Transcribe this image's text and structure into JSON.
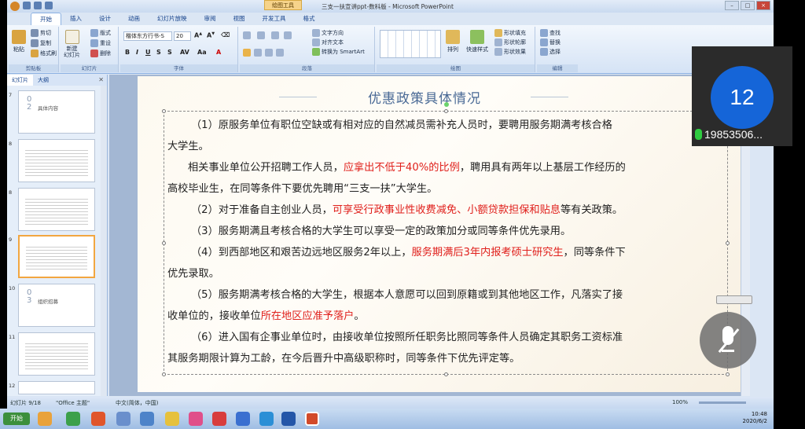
{
  "window": {
    "title": "三支一扶宣讲ppt-数科版 - Microsoft PowerPoint",
    "context_tab": "绘图工具"
  },
  "tabs": [
    "开始",
    "插入",
    "设计",
    "动画",
    "幻灯片放映",
    "审阅",
    "视图",
    "开发工具",
    "格式"
  ],
  "ribbon": {
    "clipboard": {
      "paste": "粘贴",
      "cut": "剪切",
      "copy": "复制",
      "format_painter": "格式刷",
      "label": "剪贴板"
    },
    "slides": {
      "new_slide": "新建\n幻灯片",
      "layout": "版式",
      "reset": "重设",
      "delete": "删除",
      "label": "幻灯片"
    },
    "font": {
      "family": "楷体东方行书-S",
      "size": "20",
      "label": "字体"
    },
    "paragraph": {
      "text_direction": "文字方向",
      "align_text": "对齐文本",
      "smartart": "转换为 SmartArt",
      "label": "段落"
    },
    "drawing": {
      "arrange": "排列",
      "quick_styles": "快速样式",
      "shape_fill": "形状填充",
      "shape_outline": "形状轮廓",
      "shape_effects": "形状效果",
      "label": "绘图"
    },
    "editing": {
      "find": "查找",
      "replace": "替换",
      "select": "选择",
      "label": "编辑"
    }
  },
  "left_panel": {
    "tabs": [
      "幻灯片",
      "大纲"
    ],
    "thumbs": [
      {
        "num": "7",
        "big": "0\n2",
        "title": "具体内容"
      },
      {
        "num": "8",
        "big": "",
        "title": ""
      },
      {
        "num": "8",
        "big": "",
        "title": ""
      },
      {
        "num": "9",
        "big": "",
        "title": ""
      },
      {
        "num": "10",
        "big": "0\n3",
        "title": "组织招募"
      },
      {
        "num": "11",
        "big": "",
        "title": ""
      },
      {
        "num": "12",
        "big": "",
        "title": ""
      }
    ]
  },
  "slide": {
    "title": "优惠政策具体情况",
    "paragraphs": [
      [
        {
          "t": "（1）原服务单位有职位空缺或有相对应的自然减员需补充人员时，要聘用服务期满考核合格"
        }
      ],
      [
        {
          "t": "大学生。"
        }
      ],
      [
        {
          "t": "相关事业单位公开招聘工作人员，"
        },
        {
          "t": "应拿出不低于40%的比例",
          "red": true
        },
        {
          "t": "，聘用具有两年以上基层工作经历的"
        }
      ],
      [
        {
          "t": "高校毕业生，在同等条件下要优先聘用“三支一扶”大学生。"
        }
      ],
      [
        {
          "t": "（2）对于准备自主创业人员，"
        },
        {
          "t": "可享受行政事业性收费减免、小额贷款担保和贴息",
          "red": true
        },
        {
          "t": "等有关政策。"
        }
      ],
      [
        {
          "t": "（3）服务期满且考核合格的大学生可以享受一定的政策加分或同等条件优先录用。"
        }
      ],
      [
        {
          "t": "（4）到西部地区和艰苦边远地区服务2年以上，"
        },
        {
          "t": "服务期满后3年内报考硕士研究生",
          "red": true
        },
        {
          "t": "，同等条件下"
        }
      ],
      [
        {
          "t": "优先录取。"
        }
      ],
      [
        {
          "t": "（5）服务期满考核合格的大学生，根据本人意愿可以回到原籍或到其他地区工作，凡落实了接"
        }
      ],
      [
        {
          "t": "收单位的，接收单位"
        },
        {
          "t": "所在地区应准予落户",
          "red": true
        },
        {
          "t": "。"
        }
      ],
      [
        {
          "t": "（6）进入国有企事业单位时，由接收单位按照所任职务比照同等条件人员确定其职务工资标准"
        }
      ],
      [
        {
          "t": "其服务期限计算为工龄，在今后晋升中高级职称时，同等条件下优先评定等。"
        }
      ]
    ]
  },
  "statusbar": {
    "slide": "幻灯片 9/18",
    "theme": "\"Office 主题\"",
    "lang": "中文(简体，中国)",
    "zoom": "100%"
  },
  "taskbar": {
    "start": "开始",
    "time": "10:48",
    "date": "2020/6/2"
  },
  "call": {
    "participant_count": "12",
    "participant_name": "19853506..."
  },
  "colors": {
    "accent_red": "#e0201c",
    "title_blue": "#4a6a96",
    "avatar_blue": "#1565d8"
  }
}
